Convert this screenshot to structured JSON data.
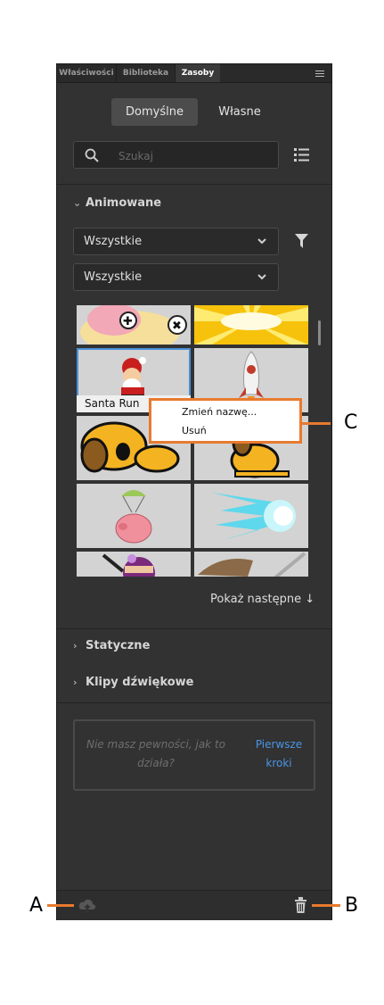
{
  "tabs": [
    {
      "label": "Właściwości"
    },
    {
      "label": "Biblioteka"
    },
    {
      "label": "Zasoby"
    }
  ],
  "segments": {
    "default_label": "Domyślne",
    "custom_label": "Własne"
  },
  "search": {
    "placeholder": "Szukaj"
  },
  "sections": {
    "animated": "Animowane",
    "static": "Statyczne",
    "sound": "Klipy dźwiękowe"
  },
  "filters": {
    "first": "Wszystkie",
    "second": "Wszystkie"
  },
  "grid": {
    "selected_label": "Santa Run",
    "items": [
      {
        "icon": "pig-bandage-icon"
      },
      {
        "icon": "sunburst-icon"
      },
      {
        "icon": "santa-icon"
      },
      {
        "icon": "rocket-icon"
      },
      {
        "icon": "dog-icon"
      },
      {
        "icon": "dog-sitting-icon"
      },
      {
        "icon": "parachute-pig-icon"
      },
      {
        "icon": "energy-blast-icon"
      },
      {
        "icon": "ninja-icon"
      },
      {
        "icon": "sword-icon"
      }
    ]
  },
  "context_menu": {
    "rename": "Zmień nazwę...",
    "delete": "Usuń"
  },
  "show_more": "Pokaż następne",
  "empty_state": {
    "text": "Nie masz pewności, jak to działa?",
    "link": "Pierwsze kroki"
  },
  "callouts": {
    "a": "A",
    "b": "B",
    "c": "C"
  },
  "colors": {
    "accent": "#e87a2e",
    "link": "#4a95e6",
    "selection": "#4a90d9",
    "panel": "#323232"
  }
}
